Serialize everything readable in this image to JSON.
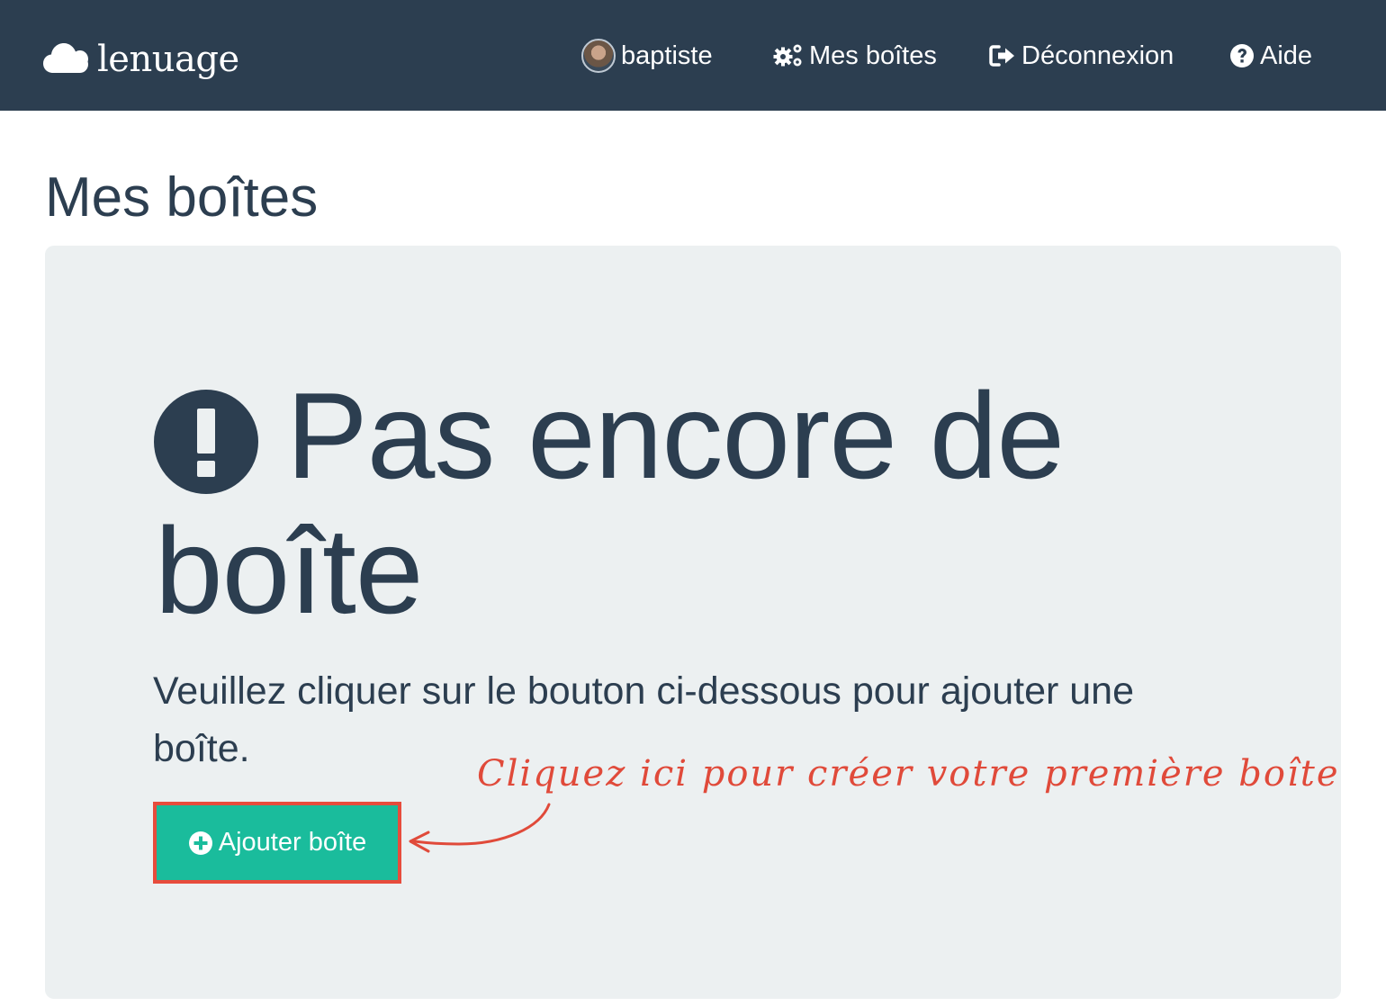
{
  "navbar": {
    "brand": "lenuage",
    "items": [
      {
        "label": "baptiste",
        "icon": "avatar"
      },
      {
        "label": "Mes boîtes",
        "icon": "gears-icon"
      },
      {
        "label": "Déconnexion",
        "icon": "sign-out-icon"
      },
      {
        "label": "Aide",
        "icon": "question-circle-icon"
      }
    ]
  },
  "page": {
    "title": "Mes boîtes"
  },
  "empty_state": {
    "icon": "exclamation-circle-icon",
    "heading_line1": "Pas encore de",
    "heading_line2": "boîte",
    "instruction": "Veuillez cliquer sur le bouton ci-dessous pour ajouter une boîte.",
    "button_label": "Ajouter boîte",
    "button_icon": "plus-circle-icon"
  },
  "annotation": {
    "text": "Cliquez ici pour créer votre première boîte"
  },
  "colors": {
    "navbar_bg": "#2c3e50",
    "text_primary": "#2c3e50",
    "panel_bg": "#ecf0f1",
    "button_bg": "#1abc9c",
    "annotation": "#e04a3a"
  }
}
